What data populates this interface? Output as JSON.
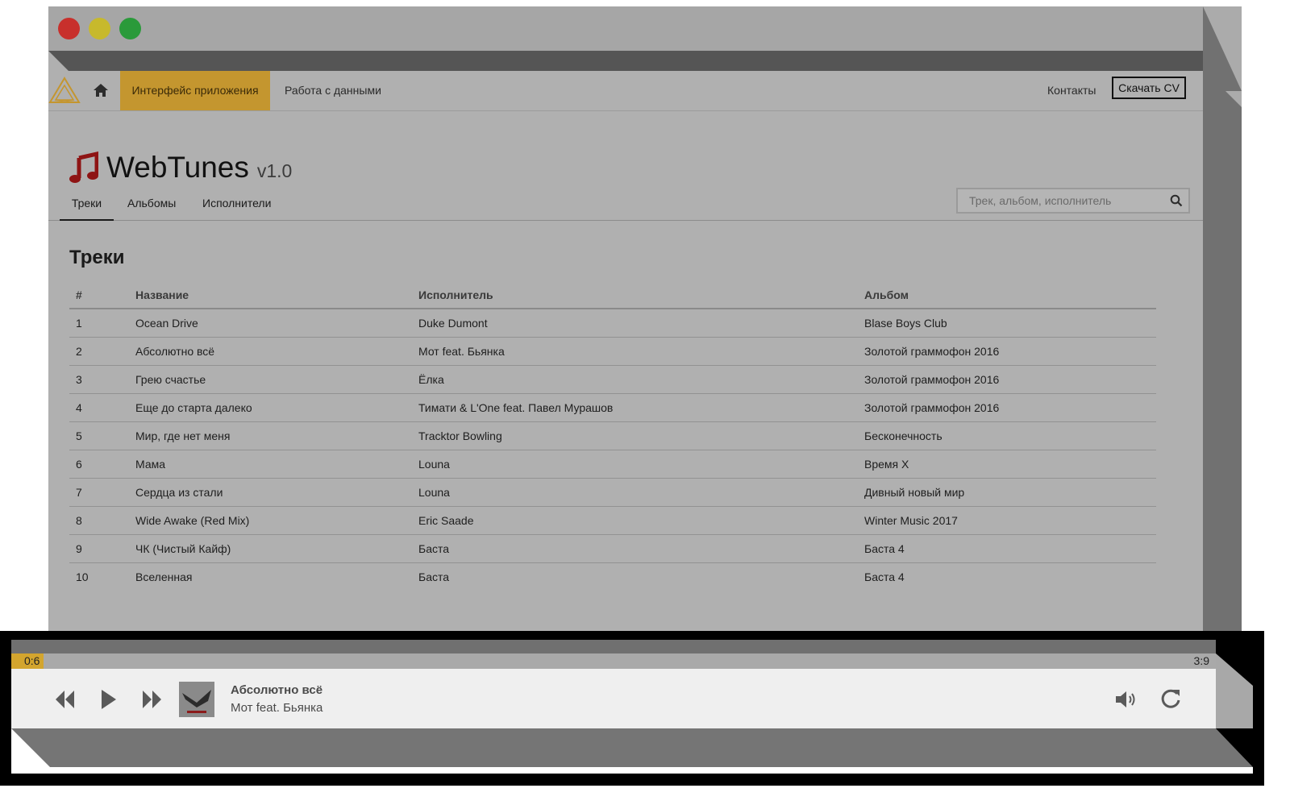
{
  "window": {
    "traffic_lights": [
      "close",
      "minimize",
      "maximize"
    ],
    "colors": {
      "close": "#c8302c",
      "minimize": "#c7b92c",
      "maximize": "#2a9a3a"
    }
  },
  "navbar": {
    "logo_icon": "triangle-logo-icon",
    "home_icon": "home-icon",
    "items": [
      {
        "label": "Интерфейс приложения",
        "active": true
      },
      {
        "label": "Работа с данными",
        "active": false
      }
    ],
    "contacts_label": "Контакты",
    "cv_button_label": "Скачать CV",
    "accent_color": "#c4962f"
  },
  "app": {
    "icon": "music-note-icon",
    "name": "WebTunes",
    "version": "v1.0",
    "tabs": [
      {
        "label": "Треки",
        "active": true
      },
      {
        "label": "Альбомы",
        "active": false
      },
      {
        "label": "Исполнители",
        "active": false
      }
    ],
    "search_placeholder": "Трек, альбом, исполнитель"
  },
  "tracks": {
    "title": "Треки",
    "columns": [
      "#",
      "Название",
      "Исполнитель",
      "Альбом"
    ],
    "rows": [
      [
        "1",
        "Ocean Drive",
        "Duke Dumont",
        "Blase Boys Club"
      ],
      [
        "2",
        "Абсолютно всё",
        "Мот feat. Бьянка",
        "Золотой граммофон 2016"
      ],
      [
        "3",
        "Грею счастье",
        "Ёлка",
        "Золотой граммофон 2016"
      ],
      [
        "4",
        "Еще до старта далеко",
        "Тимати & L'One feat. Павел Мурашов",
        "Золотой граммофон 2016"
      ],
      [
        "5",
        "Мир, где нет меня",
        "Tracktor Bowling",
        "Бесконечность"
      ],
      [
        "6",
        "Мама",
        "Louna",
        "Время X"
      ],
      [
        "7",
        "Сердца из стали",
        "Louna",
        "Дивный новый мир"
      ],
      [
        "8",
        "Wide Awake (Red Mix)",
        "Eric Saade",
        "Winter Music 2017"
      ],
      [
        "9",
        "ЧК (Чистый Кайф)",
        "Баста",
        "Баста 4"
      ],
      [
        "10",
        "Вселенная",
        "Баста",
        "Баста 4"
      ]
    ]
  },
  "player": {
    "current_time": "0:6",
    "total_time": "3:9",
    "progress_fraction": 0.027,
    "track_title": "Абсолютно всё",
    "track_artist": "Мот feat. Бьянка",
    "icons": [
      "rewind-icon",
      "play-icon",
      "fast-forward-icon",
      "volume-icon",
      "repeat-icon"
    ]
  }
}
